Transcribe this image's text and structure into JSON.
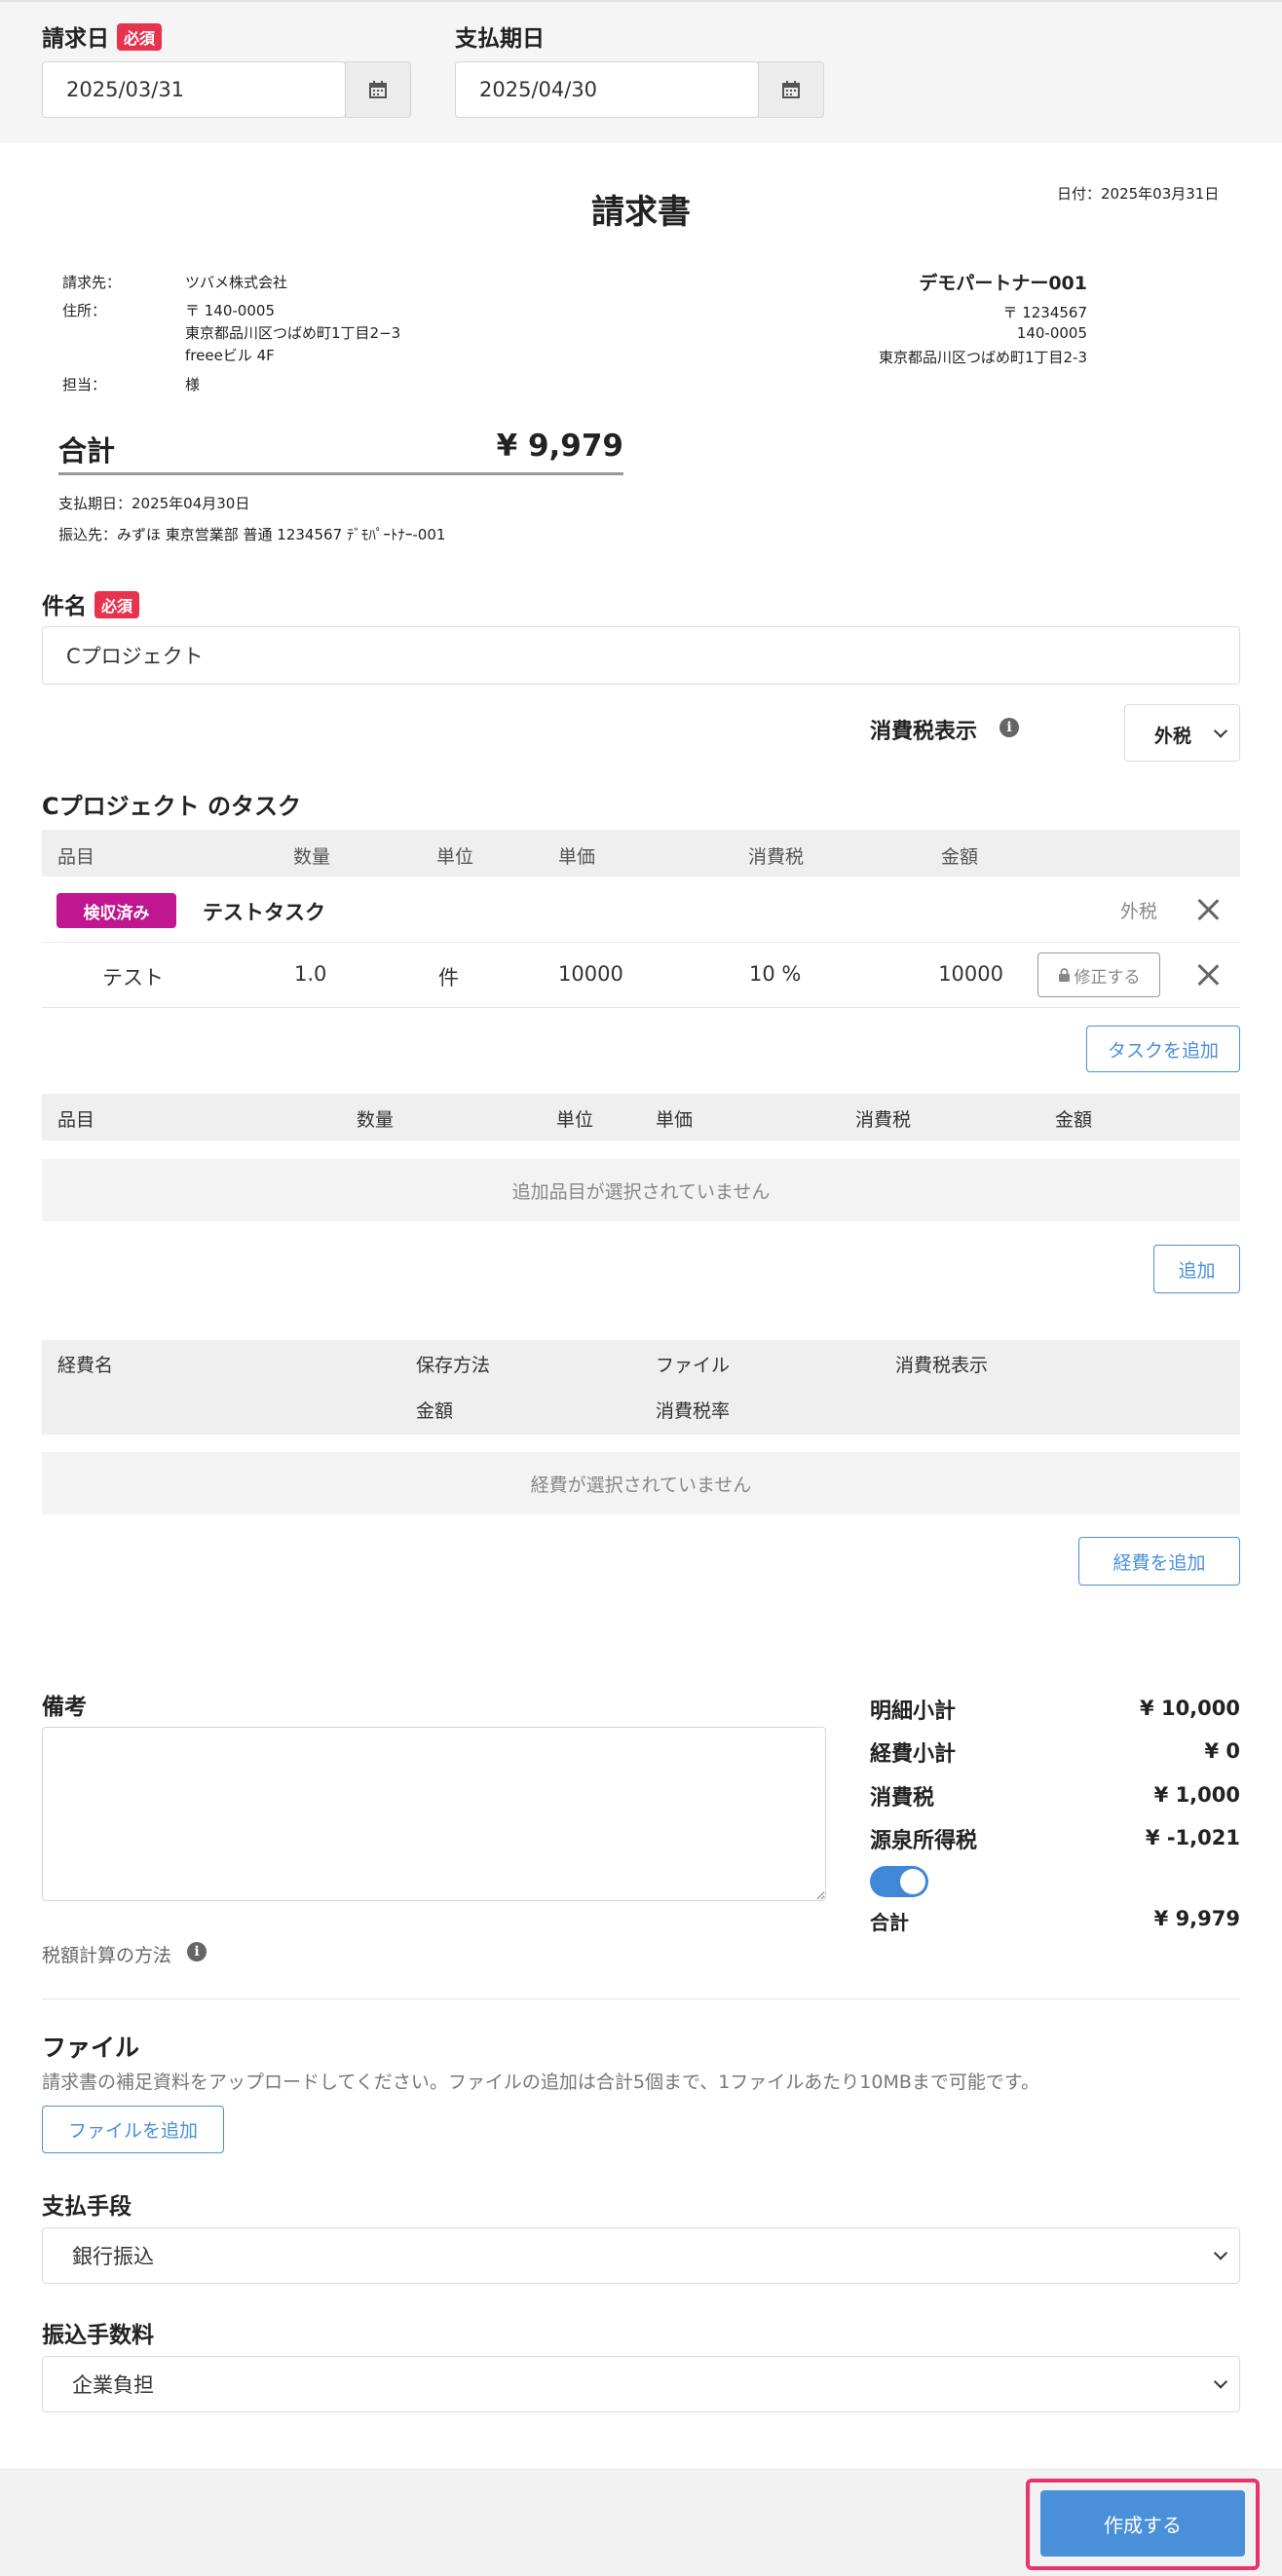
{
  "header": {
    "invoice_date_label": "請求日",
    "required_badge": "必須",
    "invoice_date_value": "2025/03/31",
    "due_date_label": "支払期日",
    "due_date_value": "2025/04/30"
  },
  "preview": {
    "title": "請求書",
    "date_text": "日付：2025年03月31日",
    "bill_to_label": "請求先：",
    "bill_to_value": "ツバメ株式会社",
    "address_label": "住所：",
    "address_line1": "〒 140-0005",
    "address_line2": "東京都品川区つばめ町1丁目2−3",
    "address_line3": "freeeビル 4F",
    "contact_label": "担当：",
    "contact_value": "様",
    "partner_name": "デモパートナー001",
    "partner_line1": "〒 1234567",
    "partner_line2": "140-0005",
    "partner_line3": "東京都品川区つばめ町1丁目2-3",
    "total_label": "合計",
    "total_value": "¥ 9,979",
    "due_text": "支払期日：2025年04月30日",
    "bank_text": "振込先：みずほ 東京営業部 普通 1234567 ﾃﾞﾓﾊﾟｰﾄﾅｰ-001"
  },
  "subject": {
    "label": "件名",
    "value": "Cプロジェクト"
  },
  "tax_display": {
    "label": "消費税表示",
    "value": "外税"
  },
  "tasks": {
    "title": "Cプロジェクト のタスク",
    "headers": [
      "品目",
      "数量",
      "単位",
      "単価",
      "消費税",
      "金額"
    ],
    "task_badge": "検収済み",
    "task_name": "テストタスク",
    "task_tax_type": "外税",
    "row": {
      "item": "テスト",
      "qty": "1.0",
      "unit": "件",
      "price": "10000",
      "tax": "10 %",
      "amount": "10000",
      "edit_label": "修正する"
    },
    "add_task_label": "タスクを追加"
  },
  "items": {
    "headers": [
      "品目",
      "数量",
      "単位",
      "単価",
      "消費税",
      "金額"
    ],
    "empty_text": "追加品目が選択されていません",
    "add_label": "追加"
  },
  "expenses": {
    "headers_row1": [
      "経費名",
      "保存方法",
      "ファイル",
      "消費税表示"
    ],
    "headers_row2": [
      "金額",
      "消費税率"
    ],
    "empty_text": "経費が選択されていません",
    "add_label": "経費を追加"
  },
  "notes": {
    "label": "備考",
    "placeholder": "",
    "tax_calc_link": "税額計算の方法"
  },
  "summary": {
    "detail_subtotal_label": "明細小計",
    "detail_subtotal_value": "¥ 10,000",
    "expense_subtotal_label": "経費小計",
    "expense_subtotal_value": "¥ 0",
    "tax_label": "消費税",
    "tax_value": "¥ 1,000",
    "withholding_label": "源泉所得税",
    "withholding_value": "¥ -1,021",
    "withholding_enabled": true,
    "total_label": "合計",
    "total_value": "¥ 9,979"
  },
  "files": {
    "label": "ファイル",
    "help": "請求書の補足資料をアップロードしてください。ファイルの追加は合計5個まで、1ファイルあたり10MBまで可能です。",
    "add_label": "ファイルを追加"
  },
  "payment_method": {
    "label": "支払手段",
    "value": "銀行振込"
  },
  "transfer_fee": {
    "label": "振込手数料",
    "value": "企業負担"
  },
  "footer": {
    "create_label": "作成する"
  },
  "colors": {
    "accent": "#4a90d9",
    "required": "#e8334e",
    "badge": "#c0168f",
    "highlight": "#e8336b"
  }
}
